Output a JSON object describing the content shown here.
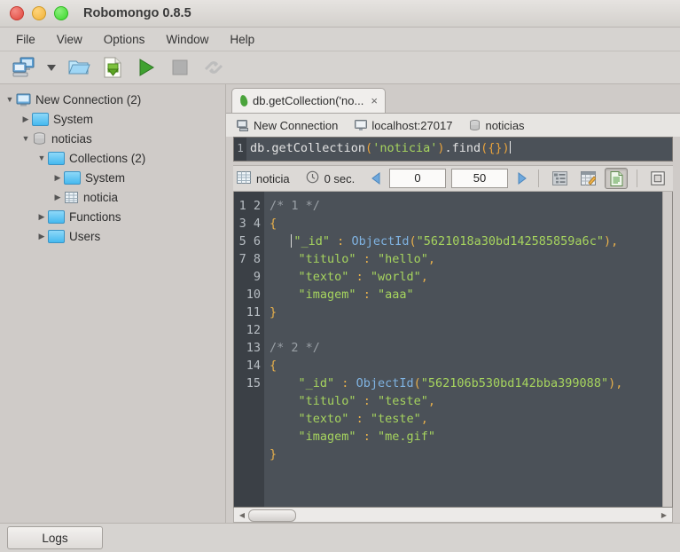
{
  "window": {
    "title": "Robomongo 0.8.5",
    "buttons": [
      "close",
      "minimize",
      "maximize"
    ]
  },
  "menu": {
    "items": [
      {
        "label": "File"
      },
      {
        "label": "View"
      },
      {
        "label": "Options"
      },
      {
        "label": "Window"
      },
      {
        "label": "Help"
      }
    ]
  },
  "toolbar": {
    "buttons": [
      {
        "name": "connect-button",
        "icon": "computer-icon",
        "enabled": true
      },
      {
        "name": "connect-dropdown",
        "icon": "chevron-down-icon",
        "enabled": true
      },
      {
        "name": "open-script-button",
        "icon": "folder-open-icon",
        "enabled": true
      },
      {
        "name": "save-script-button",
        "icon": "save-document-icon",
        "enabled": true
      },
      {
        "name": "execute-button",
        "icon": "play-icon",
        "enabled": true
      },
      {
        "name": "stop-button",
        "icon": "stop-square-icon",
        "enabled": false
      },
      {
        "name": "disconnect-button",
        "icon": "broken-link-icon",
        "enabled": false
      }
    ]
  },
  "sidebar": {
    "tree": [
      {
        "label": "New Connection (2)",
        "icon": "server-icon",
        "expanded": true,
        "indent": 1,
        "twisty": "▼"
      },
      {
        "label": "System",
        "icon": "folder-icon",
        "expanded": false,
        "indent": 2,
        "twisty": "▶"
      },
      {
        "label": "noticias",
        "icon": "database-icon",
        "expanded": true,
        "indent": 2,
        "twisty": "▼"
      },
      {
        "label": "Collections (2)",
        "icon": "folder-icon",
        "expanded": true,
        "indent": 3,
        "twisty": "▼"
      },
      {
        "label": "System",
        "icon": "folder-icon",
        "expanded": false,
        "indent": 4,
        "twisty": "▶"
      },
      {
        "label": "noticia",
        "icon": "collection-grid-icon",
        "expanded": false,
        "indent": 4,
        "twisty": "▶"
      },
      {
        "label": "Functions",
        "icon": "folder-icon",
        "expanded": false,
        "indent": 3,
        "twisty": "▶"
      },
      {
        "label": "Users",
        "icon": "folder-icon",
        "expanded": false,
        "indent": 3,
        "twisty": "▶"
      }
    ]
  },
  "tab": {
    "title": "db.getCollection('no...",
    "close_label": "×",
    "icon": "mongo-leaf-icon"
  },
  "connection_bar": {
    "connection_name": "New Connection",
    "host": "localhost:27017",
    "database": "noticias"
  },
  "query_editor": {
    "line_number": "1",
    "tokens": [
      {
        "t": "db.getCollection",
        "c": "plain"
      },
      {
        "t": "(",
        "c": "paren"
      },
      {
        "t": "'noticia'",
        "c": "string"
      },
      {
        "t": ")",
        "c": "paren"
      },
      {
        "t": ".find",
        "c": "plain"
      },
      {
        "t": "(",
        "c": "paren"
      },
      {
        "t": "{}",
        "c": "brace"
      },
      {
        "t": ")",
        "c": "paren"
      }
    ],
    "full_text": "db.getCollection('noticia').find({})"
  },
  "result_bar": {
    "collection": "noticia",
    "collection_icon": "collection-grid-icon",
    "time_icon": "clock-icon",
    "time": "0 sec.",
    "prev_label": "◀",
    "next_label": "▶",
    "skip_value": "0",
    "limit_value": "50",
    "view_modes": [
      {
        "name": "tree-view-button",
        "icon": "tree-view-icon",
        "active": false
      },
      {
        "name": "table-view-button",
        "icon": "table-view-icon",
        "active": false
      },
      {
        "name": "text-view-button",
        "icon": "document-text-icon",
        "active": true
      }
    ],
    "maximize": {
      "name": "maximize-result-button",
      "icon": "maximize-icon"
    }
  },
  "results": {
    "line_numbers": [
      "1",
      "2",
      "3",
      "4",
      "5",
      "6",
      "7",
      "8",
      "9",
      "10",
      "11",
      "12",
      "13",
      "14",
      "15"
    ],
    "documents": [
      {
        "comment": "/* 1 */",
        "fields": [
          {
            "key": "\"_id\"",
            "type": "objectid",
            "func": "ObjectId",
            "value": "\"5621018a30bd142585859a6c\"",
            "trailing": ","
          },
          {
            "key": "\"titulo\"",
            "type": "string",
            "value": "\"hello\"",
            "trailing": ","
          },
          {
            "key": "\"texto\"",
            "type": "string",
            "value": "\"world\"",
            "trailing": ","
          },
          {
            "key": "\"imagem\"",
            "type": "string",
            "value": "\"aaa\"",
            "trailing": ""
          }
        ]
      },
      {
        "comment": "/* 2 */",
        "fields": [
          {
            "key": "\"_id\"",
            "type": "objectid",
            "func": "ObjectId",
            "value": "\"562106b530bd142bba399088\"",
            "trailing": ","
          },
          {
            "key": "\"titulo\"",
            "type": "string",
            "value": "\"teste\"",
            "trailing": ","
          },
          {
            "key": "\"texto\"",
            "type": "string",
            "value": "\"teste\"",
            "trailing": ","
          },
          {
            "key": "\"imagem\"",
            "type": "string",
            "value": "\"me.gif\"",
            "trailing": ""
          }
        ]
      }
    ],
    "open_brace": "{",
    "close_brace": "}",
    "colon": ":"
  },
  "status_bar": {
    "logs_label": "Logs"
  },
  "colors": {
    "editor_bg": "#4b5158",
    "gutter_bg": "#3b4046",
    "string": "#a6d45e",
    "brace": "#e8b04b",
    "objectid": "#7fb2e0",
    "comment": "#9aa0a6",
    "chrome": "#d6d3d0",
    "accent_blue": "#46b9ef",
    "play_green": "#4aa33b"
  }
}
